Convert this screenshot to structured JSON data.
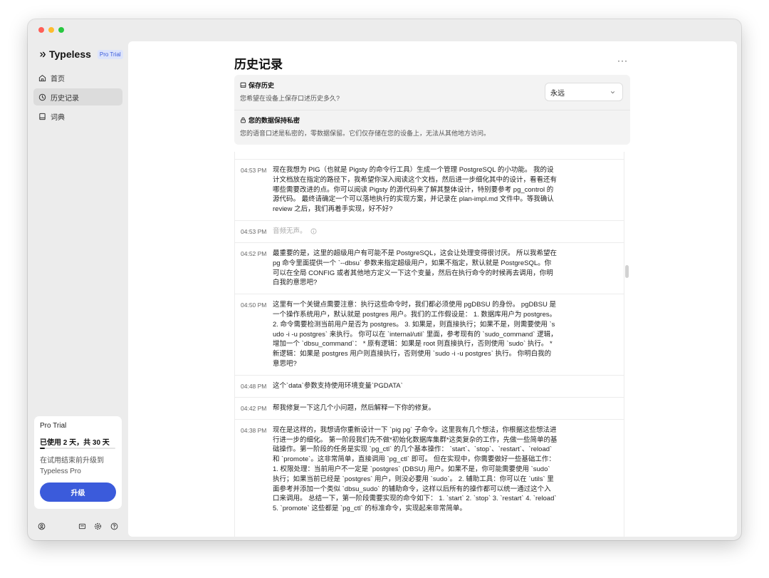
{
  "app": {
    "name": "Typeless",
    "badge": "Pro Trial",
    "traffic_lights": [
      "#ff5f57",
      "#febc2e",
      "#28c840"
    ],
    "accent": "#3b5bdb"
  },
  "sidebar": {
    "items": [
      {
        "label": "首页",
        "icon": "home-icon",
        "active": false
      },
      {
        "label": "历史记录",
        "icon": "history-clock-icon",
        "active": true
      },
      {
        "label": "词典",
        "icon": "book-icon",
        "active": false
      }
    ],
    "trial": {
      "title": "Pro Trial",
      "used": "已使用 2 天，共 30 天",
      "progress": 0.0667,
      "description": "在试用结束前升级到 Typeless Pro",
      "upgrade_label": "升级"
    },
    "footer_icons": [
      "account-icon",
      "mail-icon",
      "settings-gear-icon",
      "help-icon"
    ]
  },
  "main": {
    "title": "历史记录",
    "more_label": "···",
    "save_history": {
      "title": "保存历史",
      "description": "您希望在设备上保存口述历史多久?",
      "select_value": "永远"
    },
    "privacy": {
      "title": "您的数据保持私密",
      "description": "您的语音口述是私密的，零数据保留。它们仅存储在您的设备上，无法从其他地方访问。"
    },
    "entries": [
      {
        "time": "04:53 PM",
        "text": "现在我想为 PIG（也就是 Pigsty 的命令行工具）生成一个管理 PostgreSQL 的小功能。 我的设计文档放在指定的路径下，我希望你深入阅读这个文档，然后进一步细化其中的设计，看看还有哪些需要改进的点。你可以阅读 Pigsty 的源代码来了解其整体设计，特别要参考 pg_control 的源代码。 最终请确定一个可以落地执行的实现方案，并记录在 plan-impl.md 文件中。等我确认 review 之后，我们再着手实现，好不好?",
        "muted": false
      },
      {
        "time": "04:53 PM",
        "text": "音频无声。",
        "muted": true
      },
      {
        "time": "04:52 PM",
        "text": "最重要的是，这里的超级用户有可能不是 PostgreSQL，这会让处理变得很讨厌。 所以我希望在 pg 命令里面提供一个 `--dbsu` 参数来指定超级用户，如果不指定，默认就是 PostgreSQL。你可以在全局 CONFIG 或者其他地方定义一下这个变量，然后在执行命令的时候再去调用，你明白我的意思吧?",
        "muted": false
      },
      {
        "time": "04:50 PM",
        "text": "这里有一个关键点需要注意：执行这些命令时，我们都必须使用 pgDBSU 的身份。 pgDBSU 是一个操作系统用户，默认就是 postgres 用户。我们的工作假设是： 1. 数据库用户为 postgres。 2. 命令需要检测当前用户是否为 postgres。 3. 如果是，则直接执行；如果不是，则需要使用 `sudo -i -u postgres` 来执行。 你可以在 `internal/util` 里面，参考现有的 `sudo_command` 逻辑，增加一个 `dbsu_command`： * 原有逻辑：如果是 root 则直接执行，否则使用 `sudo` 执行。 * 新逻辑：如果是 postgres 用户则直接执行，否则使用 `sudo -i -u postgres` 执行。 你明白我的意思吧?",
        "muted": false
      },
      {
        "time": "04:48 PM",
        "text": "这个`data`参数支持使用环境变量`PGDATA`",
        "muted": false
      },
      {
        "time": "04:42 PM",
        "text": "帮我修复一下这几个小问题，然后解释一下你的修复。",
        "muted": false
      },
      {
        "time": "04:38 PM",
        "text": "现在是这样的，我想请你重新设计一下 `pig pg` 子命令。这里我有几个想法，你根据这些想法进行进一步的细化。 第一阶段我们先不做*初始化数据库集群*这类复杂的工作，先做一些简单的基础操作。第一阶段的任务是实现 `pg_ctl` 的几个基本操作： `start`、`stop`、`restart`、`reload` 和 `promote`。这非常简单，直接调用 `pg_ctl` 即可。 但在实现中，你需要做好一些基础工作： 1. 权限处理：当前用户不一定是 `postgres` (DBSU) 用户。如果不是，你可能需要使用 `sudo` 执行；如果当前已经是 `postgres` 用户，则没必要用 `sudo`。 2. 辅助工具：你可以在 `utils` 里面参考并添加一个类似 `dbsu_sudo` 的辅助命令，这样以后所有的操作都可以统一通过这个入口来调用。 总结一下，第一阶段需要实现的命令如下： 1. `start` 2. `stop` 3. `restart` 4. `reload` 5. `promote` 这些都是 `pg_ctl` 的标准命令，实现起来非常简单。",
        "muted": false
      }
    ]
  }
}
